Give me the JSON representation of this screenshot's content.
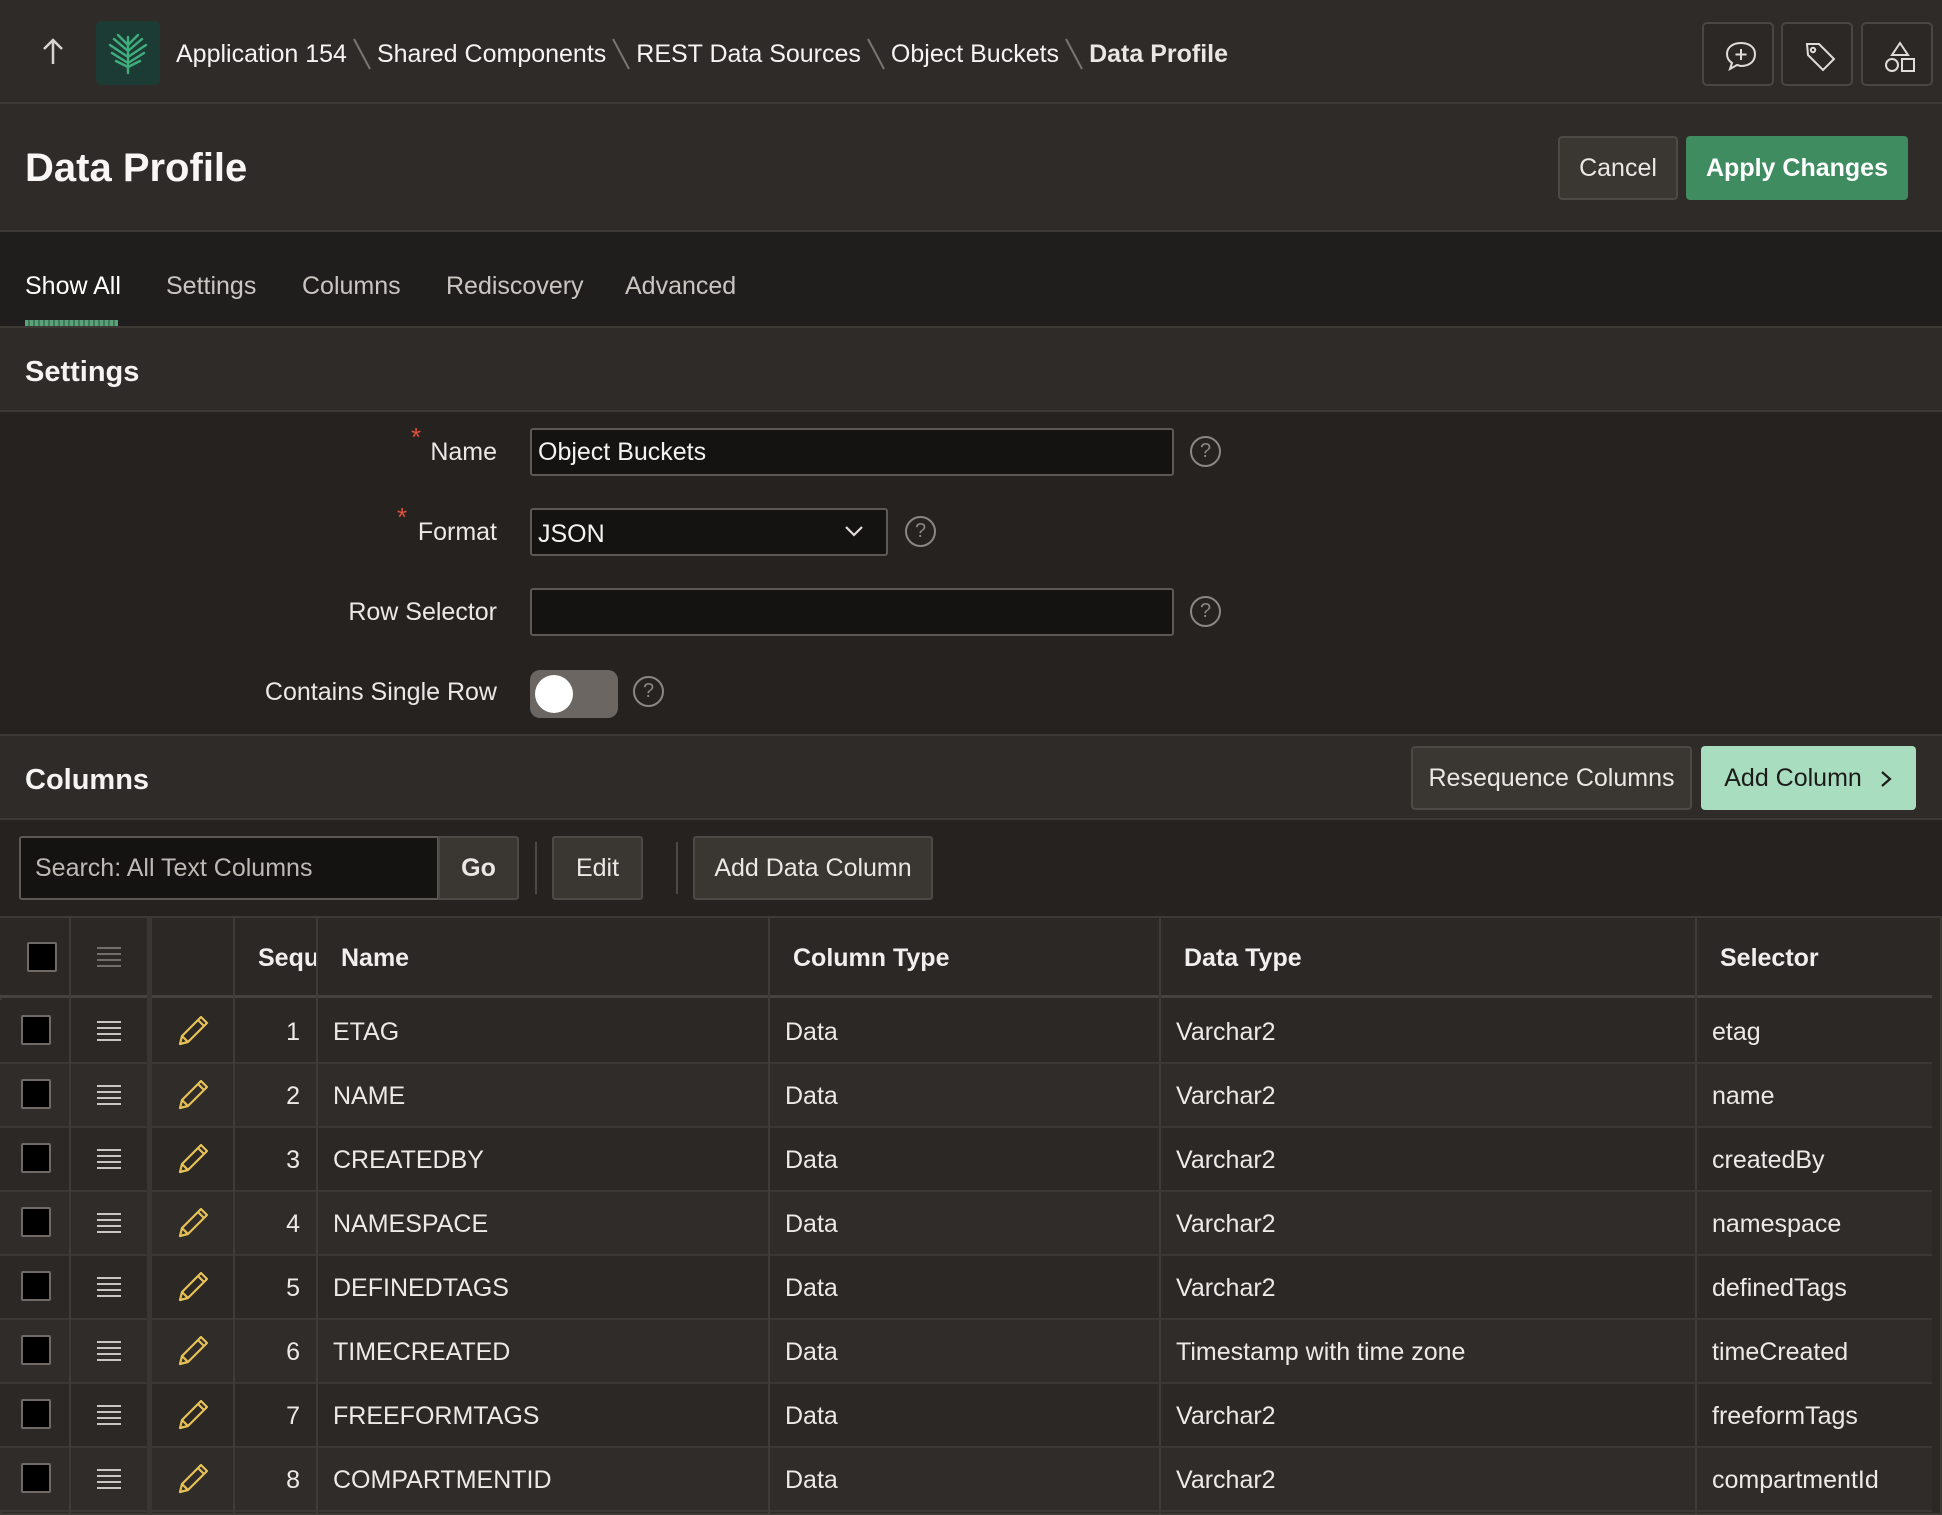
{
  "header": {
    "breadcrumb": [
      "Application 154",
      "Shared Components",
      "REST Data Sources",
      "Object Buckets",
      "Data Profile"
    ],
    "icons": [
      "up-arrow-icon",
      "app-logo-icon",
      "feedback-icon",
      "tag-icon",
      "shapes-icon"
    ]
  },
  "title": {
    "text": "Data Profile",
    "cancel_label": "Cancel",
    "apply_label": "Apply Changes"
  },
  "tabs": [
    "Show All",
    "Settings",
    "Columns",
    "Rediscovery",
    "Advanced"
  ],
  "settings": {
    "heading": "Settings",
    "name_label": "Name",
    "name_value": "Object Buckets",
    "format_label": "Format",
    "format_value": "JSON",
    "row_selector_label": "Row Selector",
    "row_selector_value": "",
    "single_row_label": "Contains Single Row",
    "help_glyph": "?"
  },
  "columns": {
    "heading": "Columns",
    "resequence_label": "Resequence Columns",
    "add_column_label": "Add Column",
    "search_placeholder": "Search: All Text Columns",
    "go_label": "Go",
    "edit_label": "Edit",
    "add_data_column_label": "Add Data Column",
    "headers": {
      "seq": "Sequ",
      "name": "Name",
      "column_type": "Column Type",
      "data_type": "Data Type",
      "selector": "Selector"
    },
    "rows": [
      {
        "seq": "1",
        "name": "ETAG",
        "column_type": "Data",
        "data_type": "Varchar2",
        "selector": "etag"
      },
      {
        "seq": "2",
        "name": "NAME",
        "column_type": "Data",
        "data_type": "Varchar2",
        "selector": "name"
      },
      {
        "seq": "3",
        "name": "CREATEDBY",
        "column_type": "Data",
        "data_type": "Varchar2",
        "selector": "createdBy"
      },
      {
        "seq": "4",
        "name": "NAMESPACE",
        "column_type": "Data",
        "data_type": "Varchar2",
        "selector": "namespace"
      },
      {
        "seq": "5",
        "name": "DEFINEDTAGS",
        "column_type": "Data",
        "data_type": "Varchar2",
        "selector": "definedTags"
      },
      {
        "seq": "6",
        "name": "TIMECREATED",
        "column_type": "Data",
        "data_type": "Timestamp with time zone",
        "selector": "timeCreated"
      },
      {
        "seq": "7",
        "name": "FREEFORMTAGS",
        "column_type": "Data",
        "data_type": "Varchar2",
        "selector": "freeformTags"
      },
      {
        "seq": "8",
        "name": "COMPARTMENTID",
        "column_type": "Data",
        "data_type": "Varchar2",
        "selector": "compartmentId"
      }
    ]
  },
  "colors": {
    "apply": "#3e8c5f",
    "add_column": "#a8ddbf",
    "required": "#e0523c",
    "pencil": "#e8c156"
  }
}
